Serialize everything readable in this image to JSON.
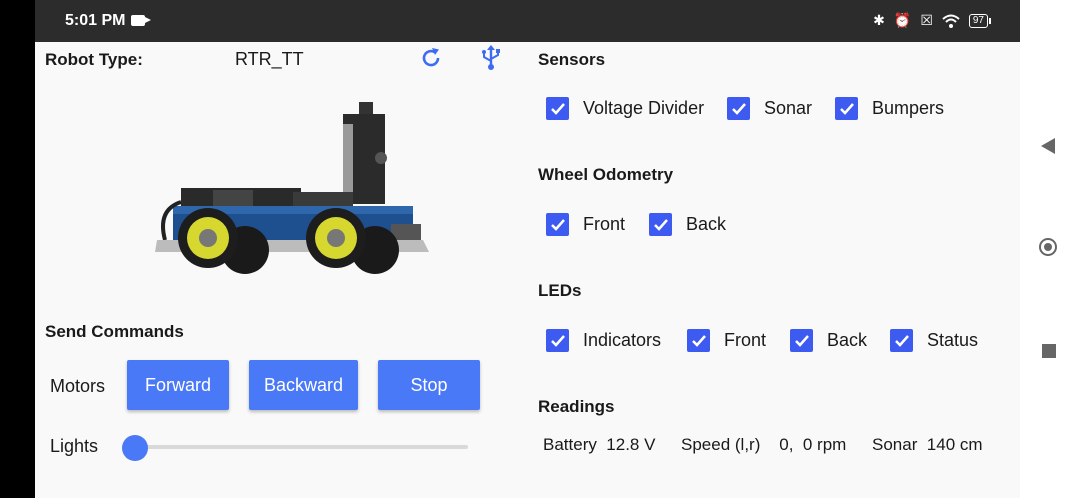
{
  "status_bar": {
    "time": "5:01 PM",
    "battery": "97",
    "icons": [
      "video-camera-icon",
      "bluetooth-icon",
      "alarm-off-icon",
      "no-sim-icon",
      "wifi-icon",
      "battery-icon"
    ]
  },
  "robot": {
    "type_label": "Robot Type:",
    "type_value": "RTR_TT",
    "refresh_icon": "refresh-icon",
    "usb_icon": "usb-icon"
  },
  "commands": {
    "title": "Send Commands",
    "motors_label": "Motors",
    "forward_label": "Forward",
    "backward_label": "Backward",
    "stop_label": "Stop",
    "lights_label": "Lights",
    "lights_value": 0
  },
  "sensors": {
    "title": "Sensors",
    "items": [
      {
        "label": "Voltage Divider",
        "checked": true
      },
      {
        "label": "Sonar",
        "checked": true
      },
      {
        "label": "Bumpers",
        "checked": true
      }
    ]
  },
  "odometry": {
    "title": "Wheel Odometry",
    "items": [
      {
        "label": "Front",
        "checked": true
      },
      {
        "label": "Back",
        "checked": true
      }
    ]
  },
  "leds": {
    "title": "LEDs",
    "items": [
      {
        "label": "Indicators",
        "checked": true
      },
      {
        "label": "Front",
        "checked": true
      },
      {
        "label": "Back",
        "checked": true
      },
      {
        "label": "Status",
        "checked": true
      }
    ]
  },
  "readings": {
    "title": "Readings",
    "battery": "Battery  12.8 V",
    "speed": "Speed (l,r)    0,  0 rpm",
    "sonar": "Sonar  140 cm"
  },
  "colors": {
    "accent": "#4a79f7",
    "checkbox": "#3d5af1",
    "status_bar": "#2c2c2c"
  }
}
